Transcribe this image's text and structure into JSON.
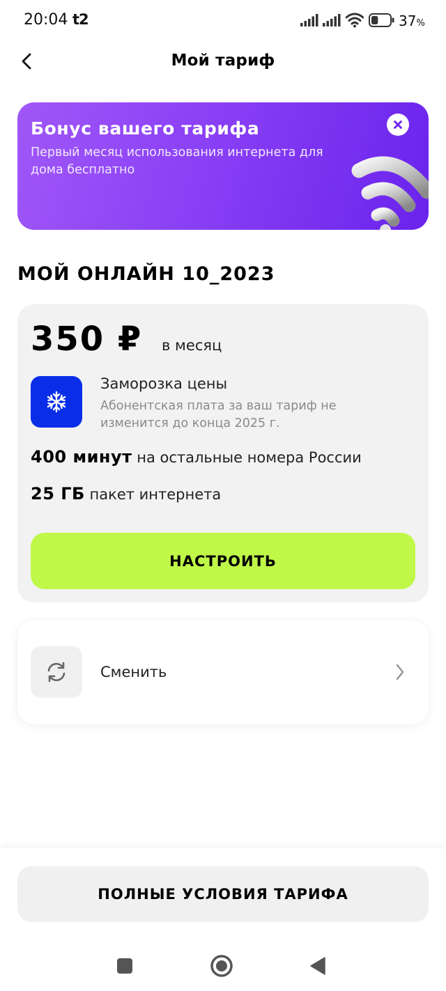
{
  "status_bar": {
    "time": "20:04",
    "carrier": "t2",
    "battery_percent": "37",
    "battery_suffix": "%",
    "battery_level": 0.37,
    "icons": [
      "signal-icon",
      "signal-icon",
      "wifi-icon",
      "battery-icon"
    ]
  },
  "header": {
    "title": "Мой тариф",
    "back_icon": "chevron-left-icon"
  },
  "bonus_banner": {
    "title": "Бонус вашего тарифа",
    "description": "Первый месяц использования интернета для дома бесплатно",
    "close_icon": "close-icon",
    "art_icon": "wifi-3d-icon",
    "gradient_start": "#a057f7",
    "gradient_end": "#6a23ec"
  },
  "tariff": {
    "name": "МОЙ ОНЛАЙН 10_2023",
    "price": "350 ₽",
    "price_period": "в месяц",
    "price_freeze": {
      "icon": "snowflake-icon",
      "title": "Заморозка цены",
      "description": "Абонентская плата за ваш тариф не изменится до конца 2025 г.",
      "icon_color": "#0a2ee8"
    },
    "features": [
      {
        "amount": "400 минут",
        "text": "на остальные номера России"
      },
      {
        "amount": "25 ГБ",
        "text": "пакет интернета"
      }
    ],
    "configure_button": "НАСТРОИТЬ",
    "accent_color": "#bff848"
  },
  "change_tariff": {
    "icon": "refresh-icon",
    "label": "Сменить",
    "chevron_icon": "chevron-right-icon"
  },
  "footer": {
    "full_terms_button": "ПОЛНЫЕ УСЛОВИЯ ТАРИФА"
  },
  "system_nav": {
    "recents_icon": "square-icon",
    "home_icon": "circle-icon",
    "back_icon": "triangle-back-icon"
  }
}
